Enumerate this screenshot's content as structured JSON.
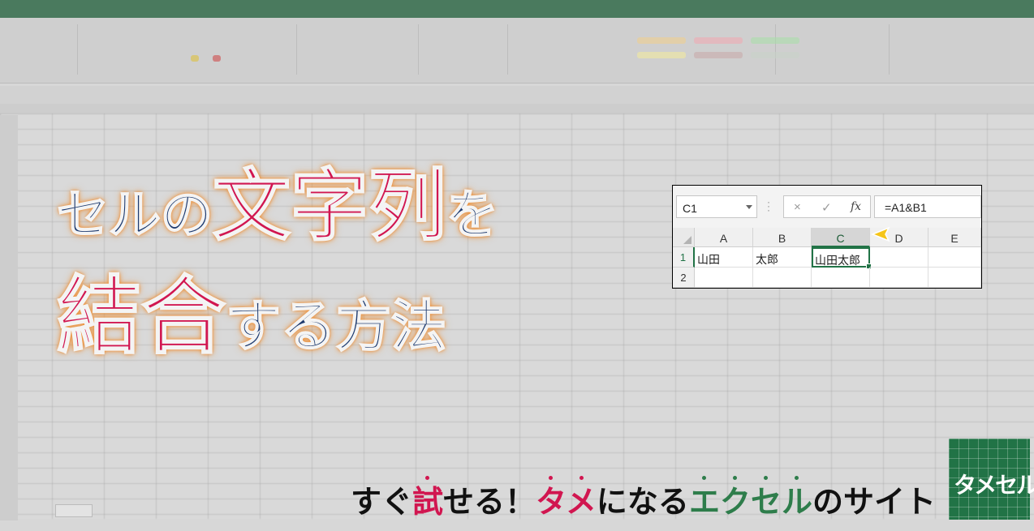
{
  "headline": {
    "line1": [
      {
        "text": "セルの",
        "style": "navy"
      },
      {
        "text": "文字列",
        "style": "red"
      },
      {
        "text": "を",
        "style": "navy"
      }
    ],
    "line2": [
      {
        "text": "結合",
        "style": "red"
      },
      {
        "text": "する方法",
        "style": "navy"
      }
    ]
  },
  "excel": {
    "name_box": "C1",
    "cancel_icon": "×",
    "enter_icon": "✓",
    "fx_label": "fx",
    "formula": "=A1&B1",
    "columns": [
      "A",
      "B",
      "C",
      "D",
      "E"
    ],
    "rows": [
      {
        "num": "1",
        "cells": [
          "山田",
          "太郎",
          "山田太郎",
          "",
          ""
        ]
      },
      {
        "num": "2",
        "cells": [
          "",
          "",
          "",
          "",
          ""
        ]
      }
    ],
    "selected_cell": "C1"
  },
  "tagline": {
    "parts": [
      {
        "text": "すぐ",
        "color": "#111111"
      },
      {
        "text": "試",
        "color": "#d11650"
      },
      {
        "text": "せる！",
        "color": "#111111"
      },
      {
        "text": "タメ",
        "color": "#d11650"
      },
      {
        "text": "になる",
        "color": "#111111"
      },
      {
        "text": "エクセル",
        "color": "#2e7d4b"
      },
      {
        "text": "のサイト",
        "color": "#111111"
      }
    ]
  },
  "logo": {
    "text": "タメセル",
    "background": "#217346"
  },
  "colors": {
    "navy": "#1e3a6e",
    "red": "#d11650",
    "glow": "#f08a2a",
    "excel_green": "#217346"
  }
}
